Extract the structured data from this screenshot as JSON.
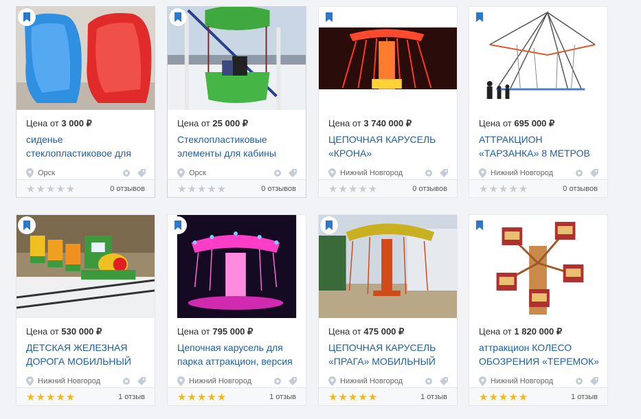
{
  "colors": {
    "link": "#1d5fa8",
    "star_full": "#f2b81b",
    "star_empty": "#c7ccd3",
    "highlight_border": "#f2d27a"
  },
  "price_prefix": "Цена от",
  "stars_glyph": "★★★★★",
  "cards": [
    {
      "price": "3 000 ₽",
      "title": "сиденье стеклопластиковое для",
      "location": "Орск",
      "reviews": "0 отзывов",
      "rating": 0,
      "image": "blue-red-seats"
    },
    {
      "price": "25 000 ₽",
      "title": "Стеклопластиковые элементы для кабины",
      "location": "Орск",
      "reviews": "0 отзывов",
      "rating": 0,
      "image": "ferris-cabin"
    },
    {
      "price": "3 740 000 ₽",
      "title": "ЦЕПОЧНАЯ КАРУСЕЛЬ «КРОНА»",
      "location": "Нижний Новгород",
      "reviews": "0 отзывов",
      "rating": 0,
      "image": "carousel-night"
    },
    {
      "price": "695 000 ₽",
      "title": "АТТРАКЦИОН «ТАРЗАНКА» 8 МЕТРОВ",
      "location": "Нижний Новгород",
      "reviews": "0 отзывов",
      "rating": 0,
      "image": "bungee-trampoline"
    },
    {
      "price": "530 000 ₽",
      "title": "ДЕТСКАЯ ЖЕЛЕЗНАЯ ДОРОГА МОБИЛЬНЫЙ",
      "location": "Нижний Новгород",
      "reviews": "1 отзыв",
      "rating": 5,
      "image": "kids-train"
    },
    {
      "price": "795 000 ₽",
      "title": "Цепочная карусель для парка аттракцион, версия",
      "location": "Нижний Новгород",
      "reviews": "1 отзыв",
      "rating": 5,
      "image": "pink-carousel"
    },
    {
      "price": "475 000 ₽",
      "title": "ЦЕПОЧНАЯ КАРУСЕЛЬ «ПРАГА» МОБИЛЬНЫЙ",
      "location": "Нижний Новгород",
      "reviews": "1 отзыв",
      "rating": 5,
      "image": "praga-carousel"
    },
    {
      "price": "1 820 000 ₽",
      "title": "аттракцион КОЛЕСО ОБОЗРЕНИЯ «ТЕРЕМОК»",
      "location": "Нижний Новгород",
      "reviews": "1 отзыв",
      "rating": 5,
      "image": "teremok-wheel"
    }
  ]
}
